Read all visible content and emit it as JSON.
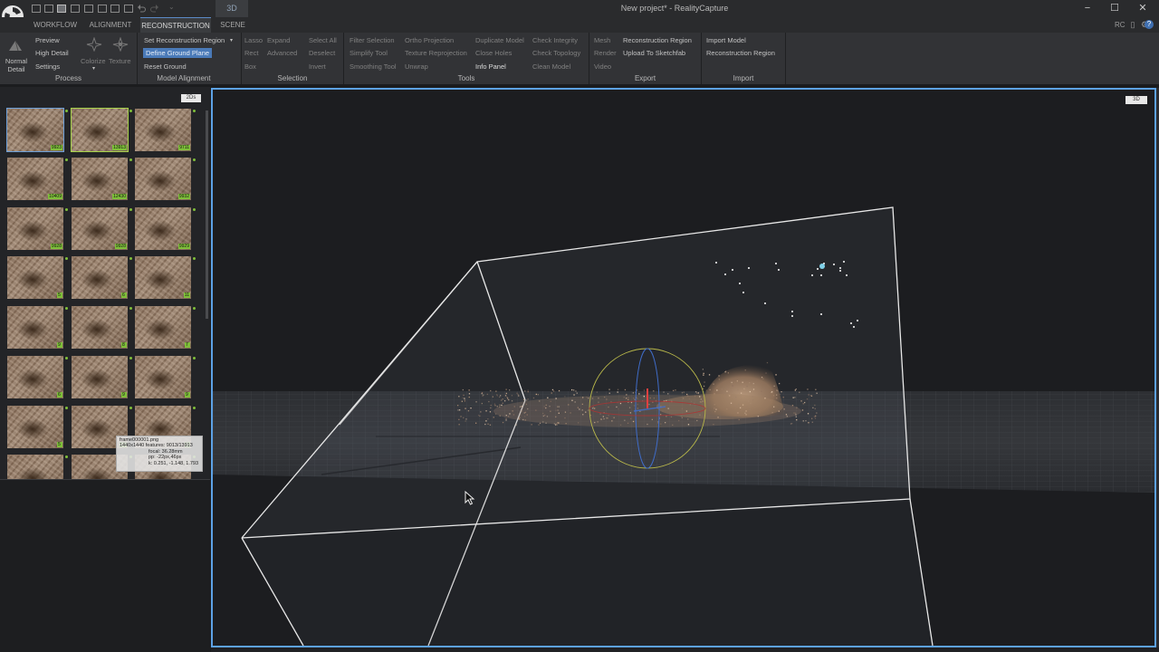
{
  "titlebar": {
    "view_tab": "3D",
    "window_title": "New project* - RealityCapture",
    "minimize": "−",
    "maximize": "☐",
    "close": "✕"
  },
  "menu": {
    "tabs": [
      "WORKFLOW",
      "ALIGNMENT",
      "RECONSTRUCTION",
      "SCENE"
    ],
    "active_tab": "RECONSTRUCTION",
    "right_label": "RC"
  },
  "ribbon": {
    "process": {
      "title": "Process",
      "normal_detail_line1": "Normal",
      "normal_detail_line2": "Detail",
      "preview": "Preview",
      "high_detail": "High Detail",
      "settings": "Settings"
    },
    "model_alignment": {
      "title": "Model Alignment",
      "colorize": "Colorize",
      "texture": "Texture",
      "set_region": "Set Reconstruction Region",
      "define_ground": "Define Ground Plane",
      "reset_ground": "Reset Ground"
    },
    "selection": {
      "title": "Selection",
      "lasso": "Lasso",
      "rect": "Rect",
      "box": "Box",
      "expand": "Expand",
      "advanced": "Advanced",
      "select_all": "Select All",
      "deselect": "Deselect",
      "invert": "Invert"
    },
    "tools": {
      "title": "Tools",
      "filter_selection": "Filter Selection",
      "simplify_tool": "Simplify Tool",
      "smoothing_tool": "Smoothing Tool",
      "ortho_projection": "Ortho Projection",
      "texture_reprojection": "Texture Reprojection",
      "unwrap": "Unwrap",
      "duplicate_model": "Duplicate Model",
      "close_holes": "Close Holes",
      "info_panel": "Info Panel",
      "check_integrity": "Check Integrity",
      "check_topology": "Check Topology",
      "clean_model": "Clean Model"
    },
    "export": {
      "title": "Export",
      "mesh": "Mesh",
      "render": "Render",
      "video": "Video",
      "reconstruction_region": "Reconstruction Region",
      "upload_sketchfab": "Upload To Sketchfab"
    },
    "import": {
      "title": "Import",
      "import_model": "Import Model",
      "reconstruction_region": "Reconstruction Region"
    }
  },
  "left_panel": {
    "badge": "2Ds",
    "thumb_badges": [
      "9923",
      "13913",
      "9711",
      "10409",
      "12430",
      "9932",
      "9928",
      "9928",
      "9929",
      "5",
      "6",
      "11",
      "9",
      "8",
      "7",
      "6",
      "9",
      "9",
      "5",
      "12",
      "5"
    ],
    "tooltip": {
      "filename": "frame000001.png",
      "size": "1440x1440",
      "features": "features: 9013/13913",
      "focal": "focal: 36.28mm",
      "pp": "pp: -22px,46px",
      "k": "k: 0.251, -1.148, 1.793"
    }
  },
  "viewport": {
    "badge": "3D"
  },
  "colors": {
    "accent": "#5da2e6",
    "active_button": "#4a7ab8",
    "image_badge": "#7fbf3a",
    "gizmo_ring": "#c6c24a"
  },
  "icons": {
    "app_logo": "realitycapture-logo-icon",
    "colorize": "colorize-icon",
    "texture": "texture-icon",
    "normal_detail": "normal-detail-icon",
    "help": "help-icon"
  }
}
